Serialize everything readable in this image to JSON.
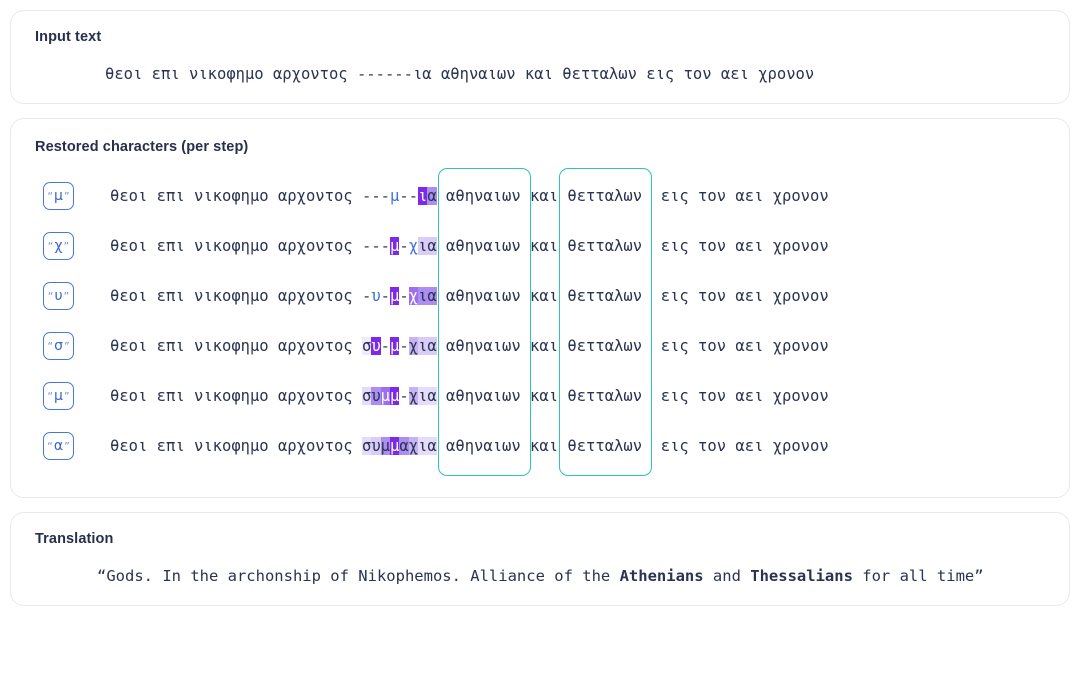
{
  "input_card": {
    "title": "Input text",
    "text": "θεοι επι νικοφημο αρχοντος ------ια αθηναιων και θετταλων εις τον αει χρονον"
  },
  "steps_card": {
    "title": "Restored characters (per step)",
    "prefix": "θεοι επι νικοφημο αρχοντος ",
    "suffix": " εις τον αει χρονον",
    "mid_left": " αθηναιων ",
    "mid_conj": "και",
    "mid_right": " θετταλων ",
    "highlight_boxes": [
      {
        "label": "athenians-box",
        "word": "αθηναιων"
      },
      {
        "label": "thessalians-box",
        "word": "θετταλων"
      }
    ],
    "steps": [
      {
        "badge": "μ",
        "gap_cells": [
          {
            "ch": "-",
            "level": 0,
            "predicted": false
          },
          {
            "ch": "-",
            "level": 0,
            "predicted": false
          },
          {
            "ch": "-",
            "level": 0,
            "predicted": false
          },
          {
            "ch": "μ",
            "level": 0,
            "predicted": true
          },
          {
            "ch": "-",
            "level": 0,
            "predicted": false
          },
          {
            "ch": "-",
            "level": 0,
            "predicted": false
          },
          {
            "ch": "ι",
            "level": 8,
            "predicted": false
          },
          {
            "ch": "α",
            "level": 5,
            "predicted": false
          }
        ]
      },
      {
        "badge": "χ",
        "gap_cells": [
          {
            "ch": "-",
            "level": 0,
            "predicted": false
          },
          {
            "ch": "-",
            "level": 0,
            "predicted": false
          },
          {
            "ch": "-",
            "level": 0,
            "predicted": false
          },
          {
            "ch": "μ",
            "level": 8,
            "predicted": false
          },
          {
            "ch": "-",
            "level": 0,
            "predicted": false
          },
          {
            "ch": "χ",
            "level": 0,
            "predicted": true
          },
          {
            "ch": "ι",
            "level": 3,
            "predicted": false
          },
          {
            "ch": "α",
            "level": 3,
            "predicted": false
          }
        ]
      },
      {
        "badge": "υ",
        "gap_cells": [
          {
            "ch": "-",
            "level": 0,
            "predicted": false
          },
          {
            "ch": "υ",
            "level": 0,
            "predicted": true
          },
          {
            "ch": "-",
            "level": 0,
            "predicted": false
          },
          {
            "ch": "μ",
            "level": 8,
            "predicted": false
          },
          {
            "ch": "-",
            "level": 0,
            "predicted": false
          },
          {
            "ch": "χ",
            "level": 6,
            "predicted": false
          },
          {
            "ch": "ι",
            "level": 5,
            "predicted": false
          },
          {
            "ch": "α",
            "level": 5,
            "predicted": false
          }
        ]
      },
      {
        "badge": "σ",
        "gap_cells": [
          {
            "ch": "σ",
            "level": 1,
            "predicted": false
          },
          {
            "ch": "υ",
            "level": 8,
            "predicted": false
          },
          {
            "ch": "-",
            "level": 0,
            "predicted": false
          },
          {
            "ch": "μ",
            "level": 8,
            "predicted": false
          },
          {
            "ch": "-",
            "level": 0,
            "predicted": false
          },
          {
            "ch": "χ",
            "level": 4,
            "predicted": false
          },
          {
            "ch": "ι",
            "level": 3,
            "predicted": false
          },
          {
            "ch": "α",
            "level": 3,
            "predicted": false
          }
        ]
      },
      {
        "badge": "μ",
        "gap_cells": [
          {
            "ch": "σ",
            "level": 2,
            "predicted": false
          },
          {
            "ch": "υ",
            "level": 5,
            "predicted": false
          },
          {
            "ch": "μ",
            "level": 6,
            "predicted": false
          },
          {
            "ch": "μ",
            "level": 8,
            "predicted": false
          },
          {
            "ch": "-",
            "level": 0,
            "predicted": false
          },
          {
            "ch": "χ",
            "level": 4,
            "predicted": false
          },
          {
            "ch": "ι",
            "level": 2,
            "predicted": false
          },
          {
            "ch": "α",
            "level": 2,
            "predicted": false
          }
        ]
      },
      {
        "badge": "α",
        "gap_cells": [
          {
            "ch": "σ",
            "level": 2,
            "predicted": false
          },
          {
            "ch": "υ",
            "level": 3,
            "predicted": false
          },
          {
            "ch": "μ",
            "level": 5,
            "predicted": false
          },
          {
            "ch": "μ",
            "level": 8,
            "predicted": false
          },
          {
            "ch": "α",
            "level": 5,
            "predicted": false
          },
          {
            "ch": "χ",
            "level": 4,
            "predicted": false
          },
          {
            "ch": "ι",
            "level": 2,
            "predicted": false
          },
          {
            "ch": "α",
            "level": 2,
            "predicted": false
          }
        ]
      }
    ]
  },
  "translation_card": {
    "title": "Translation",
    "parts": [
      {
        "text": "“Gods. In the archonship of Nikophemos. Alliance of the ",
        "bold": false
      },
      {
        "text": "Athenians",
        "bold": true
      },
      {
        "text": " and ",
        "bold": false
      },
      {
        "text": "Thessalians",
        "bold": true
      },
      {
        "text": " for all time”",
        "bold": false
      }
    ]
  },
  "colors": {
    "accent_blue": "#3d6fe0",
    "teal": "#2ec4b6",
    "purple_strong": "#7c2ae8",
    "text": "#2a3352",
    "card_border": "#e8e9ed"
  }
}
